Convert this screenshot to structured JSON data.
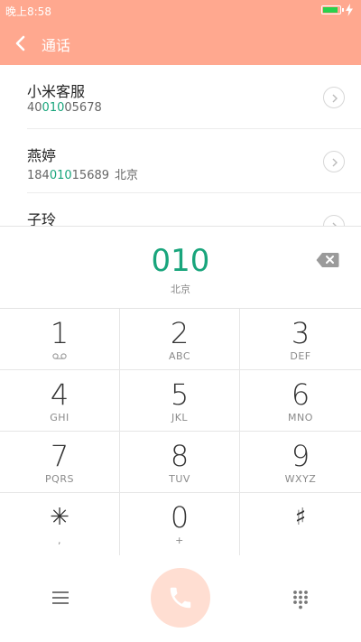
{
  "status": {
    "time": "晚上8:58"
  },
  "header": {
    "title": "通话"
  },
  "contacts": [
    {
      "name": "小米客服",
      "number_pre": "40",
      "number_match": "010",
      "number_post": "05678",
      "location": ""
    },
    {
      "name": "燕婷",
      "number_pre": "184",
      "number_match": "010",
      "number_post": "15689",
      "location": "北京"
    },
    {
      "name": "子玲",
      "number_pre": "",
      "number_match": "",
      "number_post": "",
      "location": ""
    }
  ],
  "dial": {
    "digits": "010",
    "location": "北京"
  },
  "keys": [
    {
      "num": "1",
      "letters": ""
    },
    {
      "num": "2",
      "letters": "ABC"
    },
    {
      "num": "3",
      "letters": "DEF"
    },
    {
      "num": "4",
      "letters": "GHI"
    },
    {
      "num": "5",
      "letters": "JKL"
    },
    {
      "num": "6",
      "letters": "MNO"
    },
    {
      "num": "7",
      "letters": "PQRS"
    },
    {
      "num": "8",
      "letters": "TUV"
    },
    {
      "num": "9",
      "letters": "WXYZ"
    },
    {
      "num": "✳",
      "letters": ","
    },
    {
      "num": "0",
      "letters": "+"
    },
    {
      "num": "♯",
      "letters": ""
    }
  ],
  "colors": {
    "header": "#ffa88f",
    "accent": "#19a57c",
    "call": "#ffded2",
    "battery": "#29d14c"
  },
  "icons": [
    "back-icon",
    "chevron-right-icon",
    "delete-icon",
    "voicemail-icon",
    "menu-icon",
    "phone-icon",
    "keypad-icon",
    "battery-icon",
    "charging-icon"
  ]
}
